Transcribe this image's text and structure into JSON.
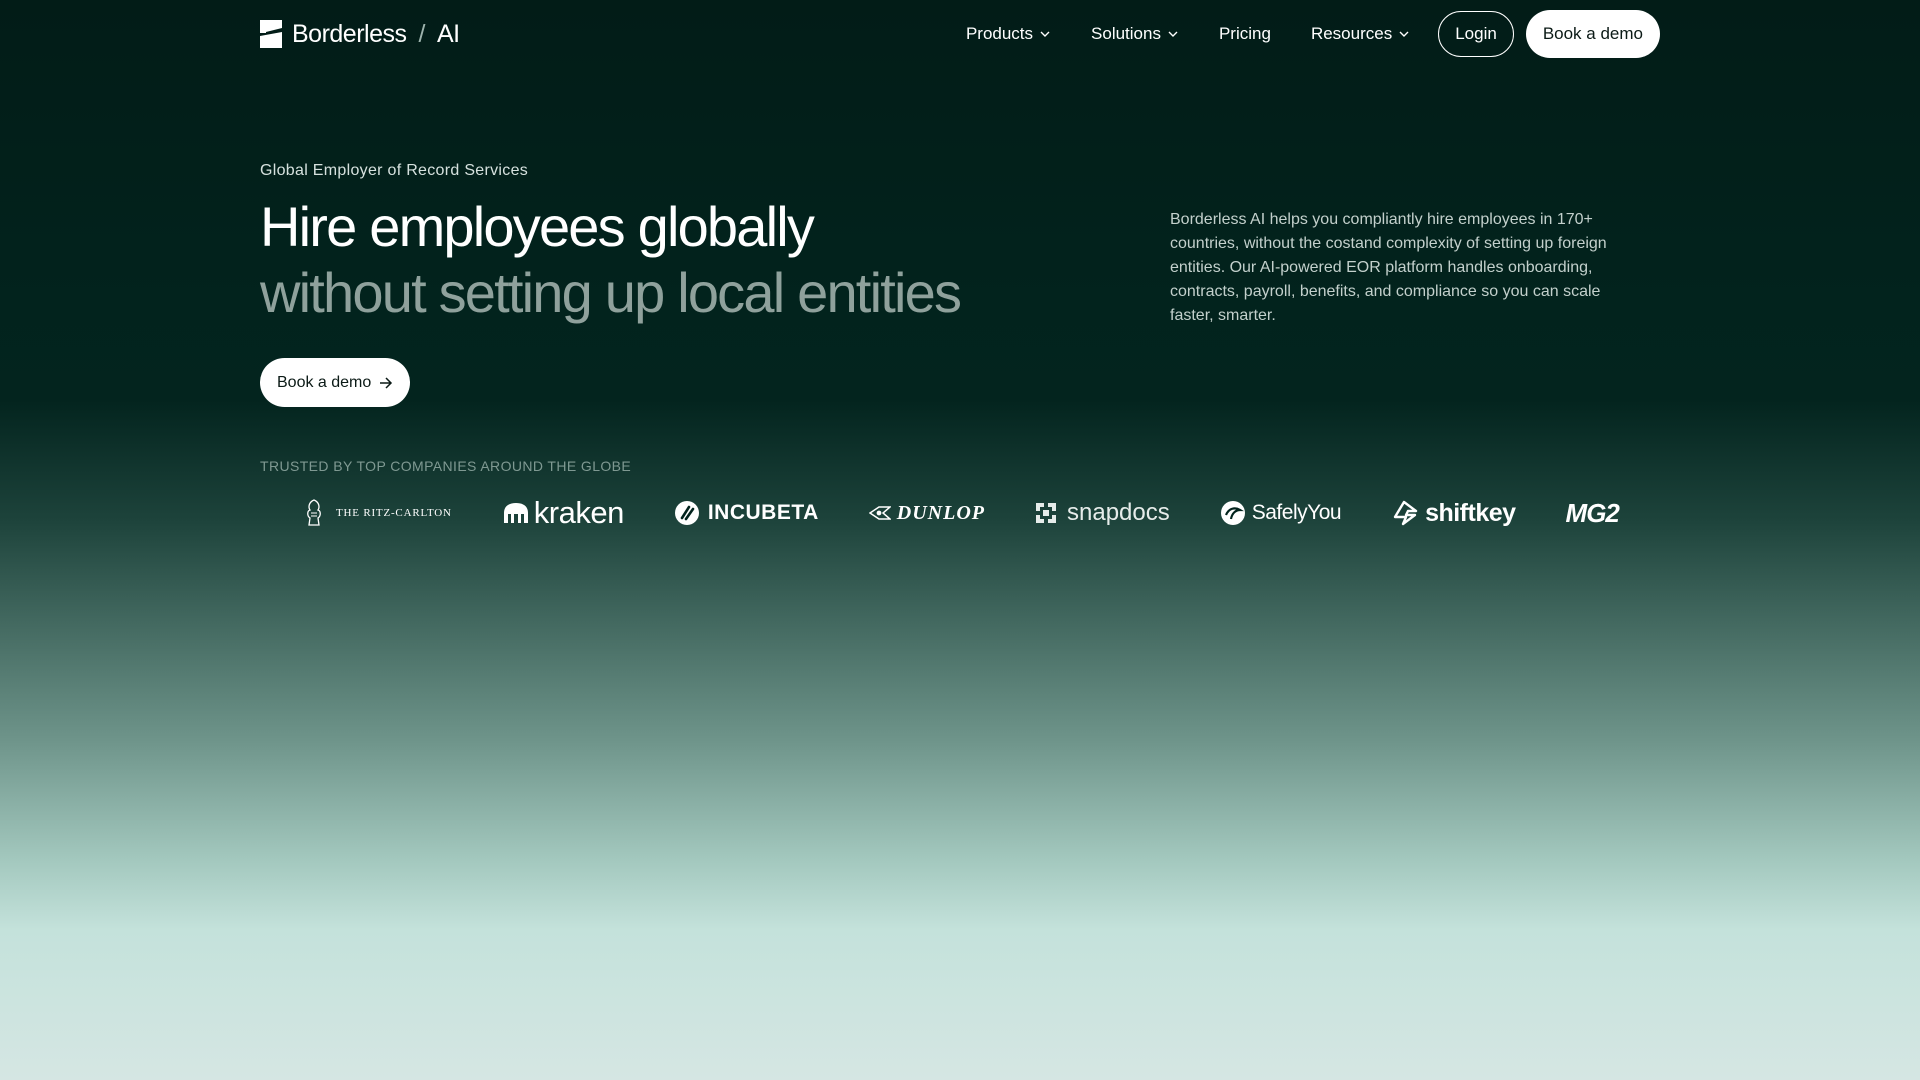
{
  "brand": {
    "name": "Borderless",
    "suffix": "AI"
  },
  "nav": {
    "items": [
      {
        "label": "Products",
        "has_dropdown": true
      },
      {
        "label": "Solutions",
        "has_dropdown": true
      },
      {
        "label": "Pricing",
        "has_dropdown": false
      },
      {
        "label": "Resources",
        "has_dropdown": true
      }
    ],
    "login_label": "Login",
    "demo_label": "Book a demo"
  },
  "hero": {
    "eyebrow": "Global Employer of Record Services",
    "headline_line1": "Hire employees globally",
    "headline_line2": "without setting up local entities",
    "cta_label": "Book a demo",
    "description": "Borderless AI helps you compliantly hire employees in 170+ countries, without the costand complexity of setting up foreign entities. Our AI-powered EOR platform handles onboarding, contracts, payroll, benefits, and compliance so you can scale faster, smarter."
  },
  "trusted": {
    "heading": "TRUSTED BY TOP COMPANIES AROUND THE GLOBE",
    "logos": {
      "ritz": "THE RITZ-CARLTON",
      "kraken": "kraken",
      "incubeta": "INCUBETA",
      "dunlop": "DUNLOP",
      "snapdocs": "snapdocs",
      "safely": "SafelyYou",
      "shiftkey": "shiftkey",
      "mg2": "MG2"
    }
  },
  "colors": {
    "bg_top": "#021c17",
    "bg_bottom": "#d5e6e3",
    "headline_muted": "#8fa19c"
  }
}
